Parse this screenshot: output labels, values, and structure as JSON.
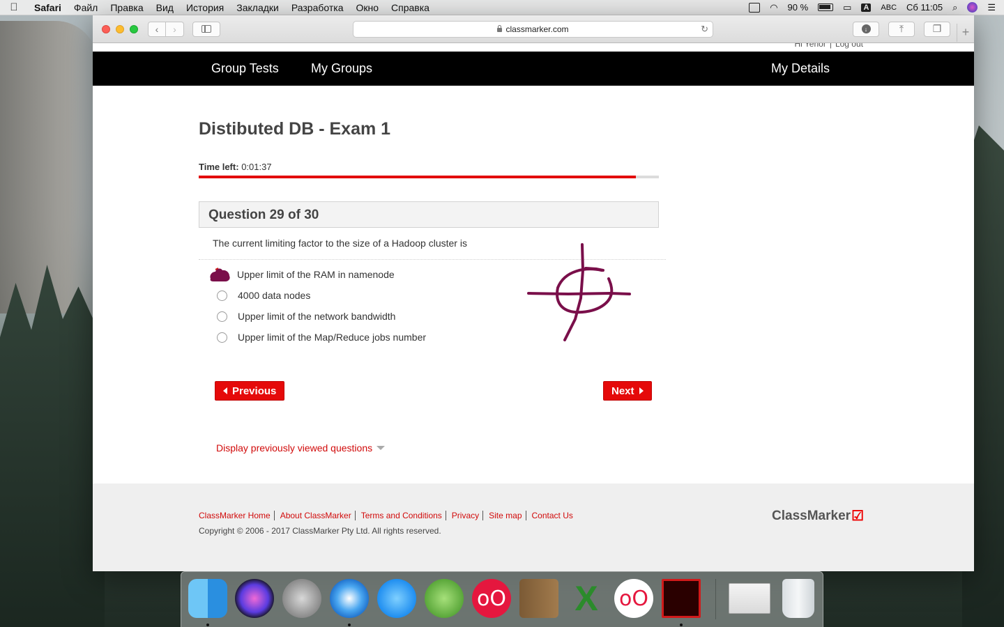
{
  "menubar": {
    "app": "Safari",
    "items": [
      "Файл",
      "Правка",
      "Вид",
      "История",
      "Закладки",
      "Разработка",
      "Окно",
      "Справка"
    ],
    "battery": "90 %",
    "input_source": "A",
    "input_name": "ABC",
    "clock": "Сб 11:05"
  },
  "browser": {
    "url": "classmarker.com"
  },
  "user": {
    "greeting": "Hi Yehor",
    "logout": "Log out"
  },
  "nav": {
    "group_tests": "Group Tests",
    "my_groups": "My Groups",
    "my_details": "My Details"
  },
  "exam": {
    "title": "Distibuted DB - Exam 1",
    "time_label": "Time left:",
    "time_value": "0:01:37",
    "time_progress": 0.95,
    "question_header": "Question 29 of 30",
    "question_text": "The current limiting factor to the size of a Hadoop cluster is",
    "answers": [
      {
        "label": "Upper limit of the RAM in namenode",
        "selected": true
      },
      {
        "label": "4000 data nodes",
        "selected": false
      },
      {
        "label": "Upper limit of the network bandwidth",
        "selected": false
      },
      {
        "label": "Upper limit of the Map/Reduce jobs number",
        "selected": false
      }
    ],
    "prev_label": "Previous",
    "next_label": "Next",
    "display_prev": "Display previously viewed questions"
  },
  "footer": {
    "links": [
      "ClassMarker Home",
      "About ClassMarker",
      "Terms and Conditions",
      "Privacy",
      "Site map",
      "Contact Us"
    ],
    "copyright": "Copyright © 2006 - 2017 ClassMarker Pty Ltd. All rights reserved.",
    "brand": "ClassMarker"
  },
  "colors": {
    "accent_red": "#e50a0a",
    "nav_bg": "#000000",
    "scribble": "#7a0f4a"
  },
  "dock": {
    "apps": [
      "finder-icon",
      "siri-icon",
      "launchpad-icon",
      "safari-icon",
      "messages-icon",
      "android-studio-icon",
      "scrobbles-icon",
      "contacts-icon",
      "excel-icon",
      "flickr-like-icon",
      "acrobat-icon",
      "window-thumbnail",
      "trash-icon"
    ]
  }
}
